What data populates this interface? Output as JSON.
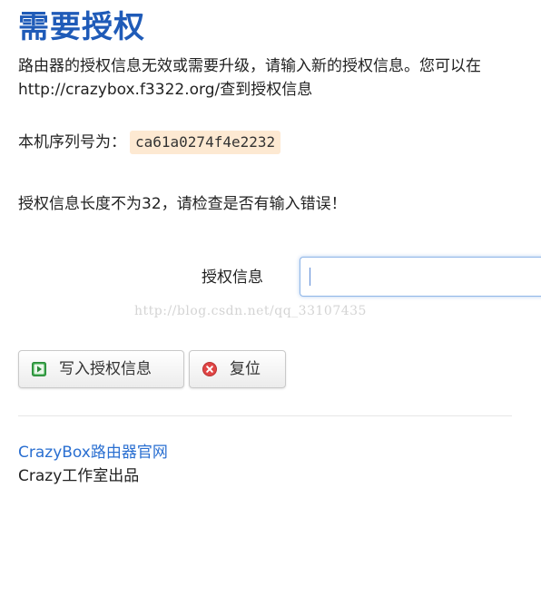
{
  "header": {
    "title": "需要授权"
  },
  "content": {
    "description": "路由器的授权信息无效或需要升级，请输入新的授权信息。您可以在http://crazybox.f3322.org/查到授权信息",
    "serial_label": "本机序列号为：",
    "serial_value": "ca61a0274f4e2232",
    "error_message": "授权信息长度不为32，请检查是否有输入错误！"
  },
  "form": {
    "auth_label": "授权信息",
    "auth_value": "",
    "submit_label": "写入授权信息",
    "reset_label": "复位"
  },
  "watermark": "http://blog.csdn.net/qq_33107435",
  "footer": {
    "link_text": "CrazyBox路由器官网",
    "credit_text": "Crazy工作室出品"
  },
  "icons": {
    "submit": "play-icon",
    "reset": "close-circle-icon"
  },
  "colors": {
    "title": "#1f5bb8",
    "link": "#2a6fd1",
    "serial_bg": "#fde9d2",
    "submit_icon": "#3aa64a",
    "reset_icon": "#e04545"
  }
}
